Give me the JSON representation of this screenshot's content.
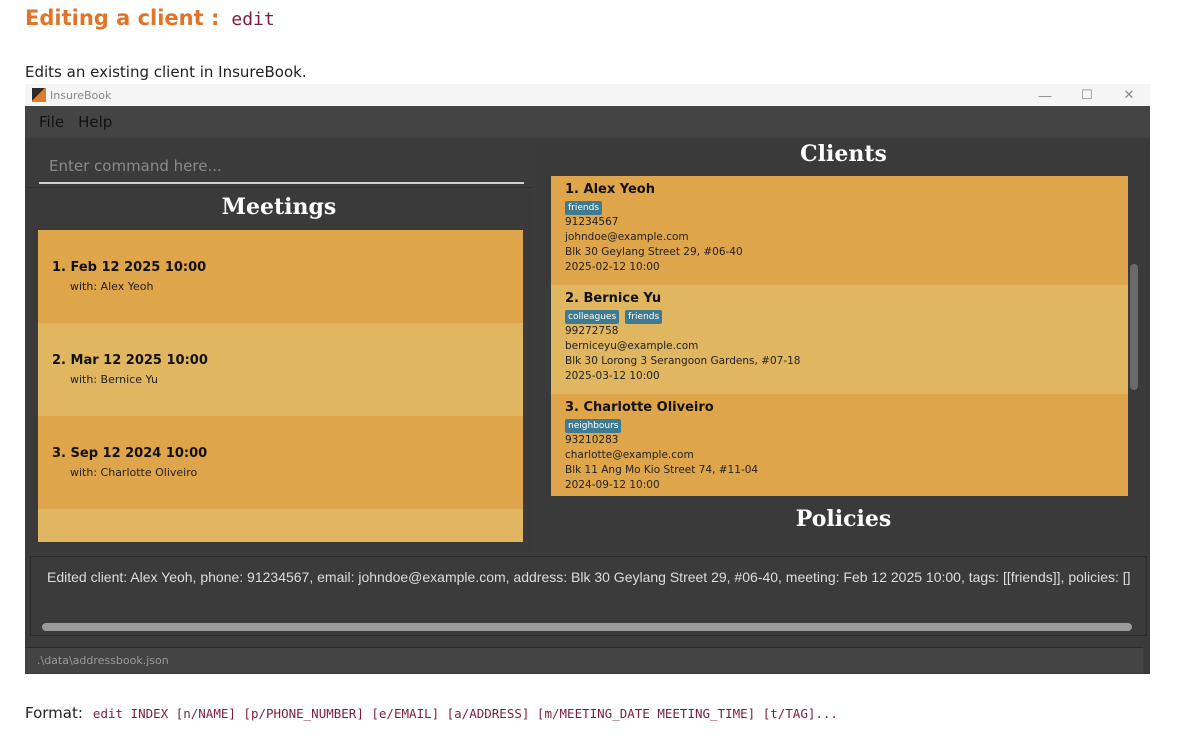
{
  "doc": {
    "heading": "Editing a client :",
    "heading_code": "edit",
    "description": "Edits an existing client in InsureBook.",
    "format_label": "Format:",
    "format_code": "edit INDEX [n/NAME] [p/PHONE_NUMBER] [e/EMAIL] [a/ADDRESS] [m/MEETING_DATE MEETING_TIME] [t/TAG]..."
  },
  "window": {
    "title": "InsureBook",
    "controls": {
      "minimize": "—",
      "maximize": "☐",
      "close": "✕"
    }
  },
  "menu": {
    "file": "File",
    "help": "Help"
  },
  "command": {
    "placeholder": "Enter command here..."
  },
  "meetings": {
    "heading": "Meetings",
    "items": [
      {
        "title": "1.  Feb 12 2025 10:00",
        "with": "with: Alex Yeoh"
      },
      {
        "title": "2.  Mar 12 2025 10:00",
        "with": "with: Bernice Yu"
      },
      {
        "title": "3.  Sep 12 2024 10:00",
        "with": "with: Charlotte Oliveiro"
      }
    ]
  },
  "clients": {
    "heading": "Clients",
    "items": [
      {
        "name": "1.  Alex Yeoh",
        "tags": [
          "friends"
        ],
        "phone": "91234567",
        "email": "johndoe@example.com",
        "address": "Blk 30 Geylang Street 29, #06-40",
        "meeting": "2025-02-12 10:00"
      },
      {
        "name": "2.  Bernice Yu",
        "tags": [
          "colleagues",
          "friends"
        ],
        "phone": "99272758",
        "email": "berniceyu@example.com",
        "address": "Blk 30 Lorong 3 Serangoon Gardens, #07-18",
        "meeting": "2025-03-12 10:00"
      },
      {
        "name": "3.  Charlotte Oliveiro",
        "tags": [
          "neighbours"
        ],
        "phone": "93210283",
        "email": "charlotte@example.com",
        "address": "Blk 11 Ang Mo Kio Street 74, #11-04",
        "meeting": "2024-09-12 10:00"
      }
    ]
  },
  "policies": {
    "heading": "Policies"
  },
  "result": {
    "text": "Edited client: Alex Yeoh, phone: 91234567, email: johndoe@example.com, address: Blk 30 Geylang Street 29, #06-40, meeting: Feb 12 2025 10:00, tags: [[friends]], policies: []"
  },
  "status": {
    "path": ".\\data\\addressbook.json"
  }
}
